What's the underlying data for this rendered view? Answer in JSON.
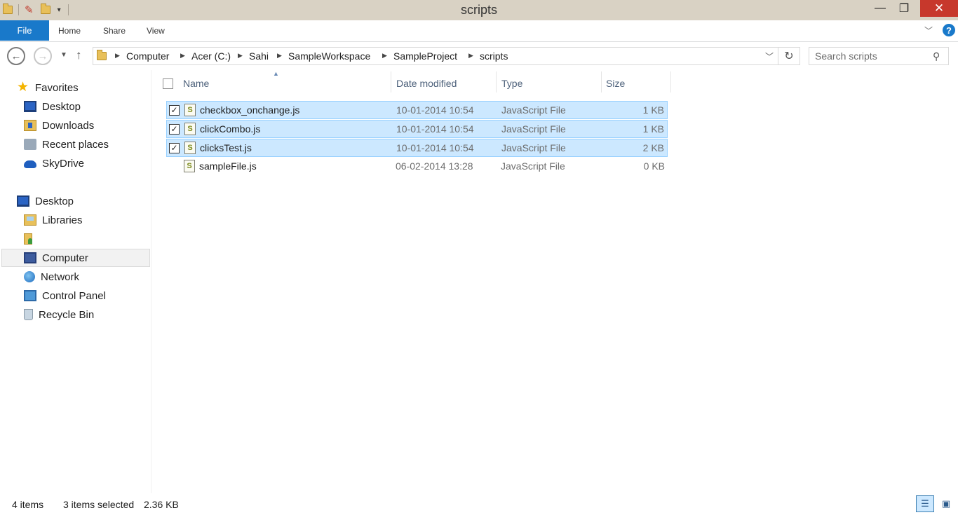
{
  "window": {
    "title": "scripts",
    "minimize_glyph": "—",
    "maximize_glyph": "❐",
    "close_glyph": "✕"
  },
  "ribbon": {
    "tabs": [
      "File",
      "Home",
      "Share",
      "View"
    ],
    "help_glyph": "?"
  },
  "address": {
    "breadcrumbs": [
      "Computer",
      "Acer (C:)",
      "Sahi",
      "SampleWorkspace",
      "SampleProject",
      "scripts"
    ],
    "search_placeholder": "Search scripts"
  },
  "nav": {
    "favorites": {
      "label": "Favorites",
      "items": [
        "Desktop",
        "Downloads",
        "Recent places",
        "SkyDrive"
      ]
    },
    "desktop": {
      "label": "Desktop",
      "items": [
        "Libraries",
        "",
        "Computer",
        "Network",
        "Control Panel",
        "Recycle Bin"
      ]
    },
    "selected_item": "Computer"
  },
  "filelist": {
    "columns": [
      "Name",
      "Date modified",
      "Type",
      "Size"
    ],
    "files": [
      {
        "name": "checkbox_onchange.js",
        "date": "10-01-2014 10:54",
        "type": "JavaScript File",
        "size": "1 KB",
        "selected": true
      },
      {
        "name": "clickCombo.js",
        "date": "10-01-2014 10:54",
        "type": "JavaScript File",
        "size": "1 KB",
        "selected": true
      },
      {
        "name": "clicksTest.js",
        "date": "10-01-2014 10:54",
        "type": "JavaScript File",
        "size": "2 KB",
        "selected": true
      },
      {
        "name": "sampleFile.js",
        "date": "06-02-2014 13:28",
        "type": "JavaScript File",
        "size": "0 KB",
        "selected": false
      }
    ]
  },
  "status": {
    "item_count": "4 items",
    "selected": "3 items selected",
    "selected_size": "2.36 KB"
  },
  "colors": {
    "accent": "#1979ca",
    "selection": "#cce8ff",
    "selection_border": "#99d1ff",
    "titlebar": "#d9d2c4",
    "close": "#c7382c"
  },
  "icons": {
    "file": "javascript-file-icon",
    "nav": [
      "star-icon",
      "desktop-icon",
      "downloads-icon",
      "recent-places-icon",
      "skydrive-icon",
      "libraries-icon",
      "user-folder-icon",
      "computer-icon",
      "network-icon",
      "control-panel-icon",
      "recycle-bin-icon"
    ]
  }
}
